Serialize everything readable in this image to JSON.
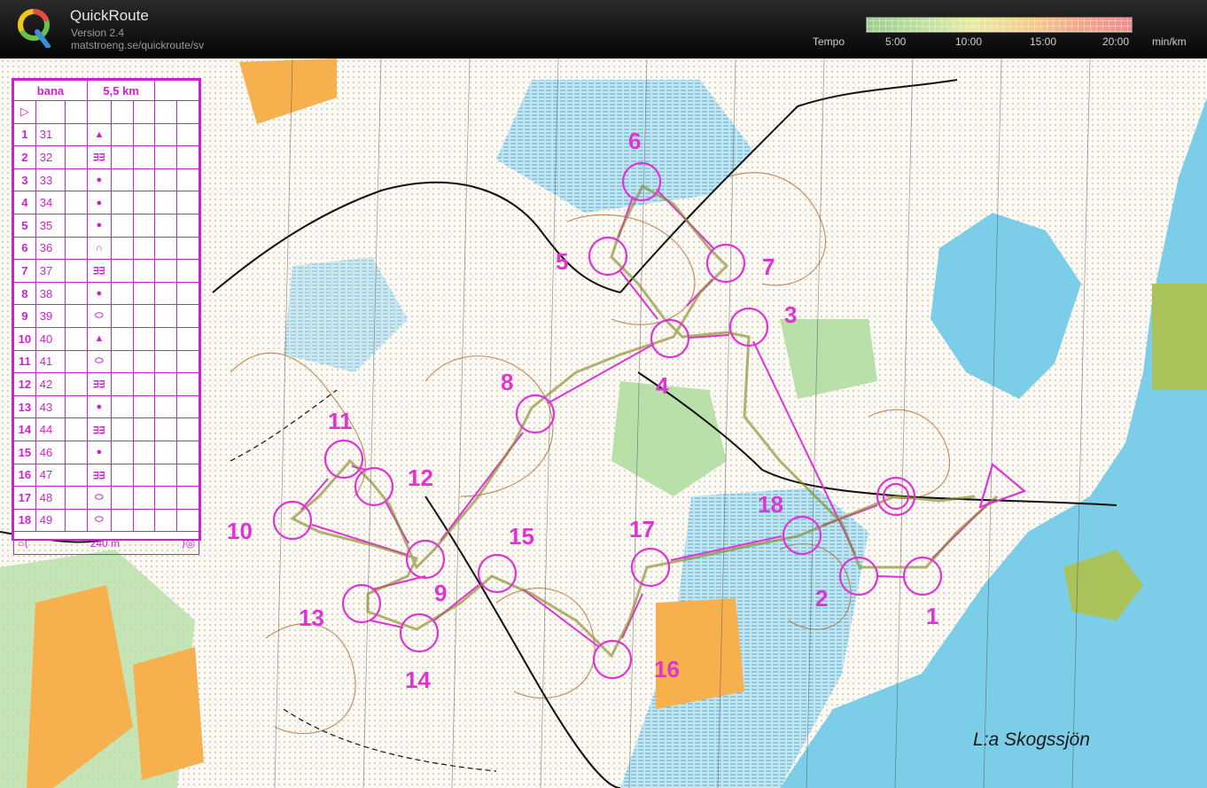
{
  "header": {
    "app_title": "QuickRoute",
    "version": "Version 2.4",
    "url": "matstroeng.se/quickroute/sv",
    "tempo_label": "Tempo",
    "tempo_ticks": [
      "5:00",
      "10:00",
      "15:00",
      "20:00"
    ],
    "unit": "min/km",
    "colors": {
      "slow": "#ee8d90",
      "medium": "#f3d08f",
      "fast": "#9ccf8e"
    }
  },
  "control_card": {
    "class_label": "bana",
    "length": "5,5 km",
    "start_symbol": "▷",
    "rows": [
      {
        "n": "1",
        "code": "31",
        "symbol": "▲"
      },
      {
        "n": "2",
        "code": "32",
        "symbol": "ᴟᴟ"
      },
      {
        "n": "3",
        "code": "33",
        "symbol": "●"
      },
      {
        "n": "4",
        "code": "34",
        "symbol": "●"
      },
      {
        "n": "5",
        "code": "35",
        "symbol": "●"
      },
      {
        "n": "6",
        "code": "36",
        "symbol": "∩"
      },
      {
        "n": "7",
        "code": "37",
        "symbol": "ᴟᴟ"
      },
      {
        "n": "8",
        "code": "38",
        "symbol": "●"
      },
      {
        "n": "9",
        "code": "39",
        "symbol": "⬭"
      },
      {
        "n": "10",
        "code": "40",
        "symbol": "▲"
      },
      {
        "n": "11",
        "code": "41",
        "symbol": "⬭"
      },
      {
        "n": "12",
        "code": "42",
        "symbol": "ᴟᴟ"
      },
      {
        "n": "13",
        "code": "43",
        "symbol": "●"
      },
      {
        "n": "14",
        "code": "44",
        "symbol": "ᴟᴟ"
      },
      {
        "n": "15",
        "code": "46",
        "symbol": "●"
      },
      {
        "n": "16",
        "code": "47",
        "symbol": "ᴟᴟ"
      },
      {
        "n": "17",
        "code": "48",
        "symbol": "⬭"
      },
      {
        "n": "18",
        "code": "49",
        "symbol": "⬭"
      }
    ],
    "finish_distance": "240 m"
  },
  "map": {
    "lake_name": "L:a Skogssjön",
    "course_color": "#e033d6",
    "controls": [
      {
        "id": "1",
        "label": "1"
      },
      {
        "id": "2",
        "label": "2"
      },
      {
        "id": "3",
        "label": "3"
      },
      {
        "id": "4",
        "label": "4"
      },
      {
        "id": "5",
        "label": "5"
      },
      {
        "id": "6",
        "label": "6"
      },
      {
        "id": "7",
        "label": "7"
      },
      {
        "id": "8",
        "label": "8"
      },
      {
        "id": "9",
        "label": "9"
      },
      {
        "id": "10",
        "label": "10"
      },
      {
        "id": "11",
        "label": "11"
      },
      {
        "id": "12",
        "label": "12"
      },
      {
        "id": "13",
        "label": "13"
      },
      {
        "id": "14",
        "label": "14"
      },
      {
        "id": "15",
        "label": "15"
      },
      {
        "id": "16",
        "label": "16"
      },
      {
        "id": "17",
        "label": "17"
      },
      {
        "id": "18",
        "label": "18"
      }
    ]
  }
}
